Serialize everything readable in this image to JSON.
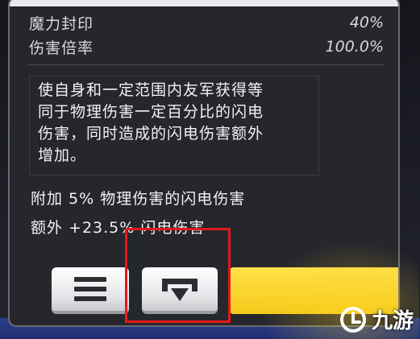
{
  "stats": [
    {
      "name": "魔力封印",
      "value": "40%"
    },
    {
      "name": "伤害倍率",
      "value": "100.0%"
    }
  ],
  "description": {
    "lines": [
      "使自身和一定范围内友军获得等",
      "同于物理伤害一定百分比的闪电",
      "伤害，同时造成的闪电伤害额外",
      "增加。"
    ]
  },
  "bonuses": [
    "附加 5% 物理伤害的闪电伤害",
    "额外 +23.5% 闪电伤害"
  ],
  "buttons": {
    "list_icon": "list-icon",
    "download_icon": "download-arrow-icon"
  },
  "watermark": {
    "text": "九游"
  },
  "colors": {
    "panel": "#26272d",
    "accent_yellow": "#f5c91a",
    "highlight_red": "#e01a1a",
    "bottom_blue": "#2a3f8e"
  }
}
